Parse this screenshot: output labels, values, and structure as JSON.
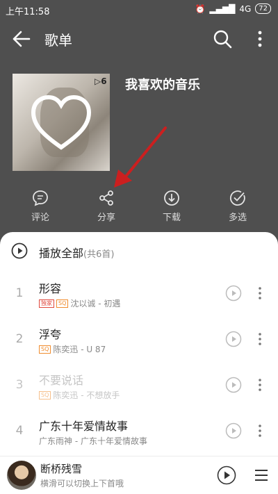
{
  "status_bar": {
    "time": "上午11:58",
    "network": "4G",
    "battery": "72"
  },
  "app_bar": {
    "title": "歌单",
    "icons": [
      "back-arrow-icon",
      "search-icon",
      "more-vertical-icon"
    ]
  },
  "playlist": {
    "name": "我喜欢的音乐",
    "play_count": "6",
    "cover_icon": "heart-icon"
  },
  "actions": [
    {
      "label": "评论",
      "icon": "comment-icon"
    },
    {
      "label": "分享",
      "icon": "share-icon"
    },
    {
      "label": "下载",
      "icon": "download-icon"
    },
    {
      "label": "多选",
      "icon": "multiselect-icon"
    }
  ],
  "annotation": {
    "color": "#cc1f1f"
  },
  "play_all": {
    "label": "播放全部",
    "count": "(共6首)"
  },
  "tracks": [
    {
      "num": "1",
      "title": "形容",
      "subtitle": "沈以诚 - 初遇",
      "badges": [
        "独家",
        "SQ"
      ],
      "dim": false
    },
    {
      "num": "2",
      "title": "浮夸",
      "subtitle": "陈奕迅 - U 87",
      "badges": [
        "SQ"
      ],
      "dim": false
    },
    {
      "num": "3",
      "title": "不要说话",
      "subtitle": "陈奕迅 - 不想放手",
      "badges": [
        "SQ"
      ],
      "dim": true
    },
    {
      "num": "4",
      "title": "广东十年爱情故事",
      "subtitle": "广东雨神 - 广东十年爱情故事",
      "badges": [],
      "dim": false
    }
  ],
  "mini_player": {
    "title": "断桥残雪",
    "subtitle": "横滑可以切换上下首哦"
  },
  "colors": {
    "header_bg": "#4f4f4f",
    "accent_red": "#cc1f1f",
    "badge_exclusive": "#e0473c",
    "badge_sq": "#f08c2e"
  }
}
